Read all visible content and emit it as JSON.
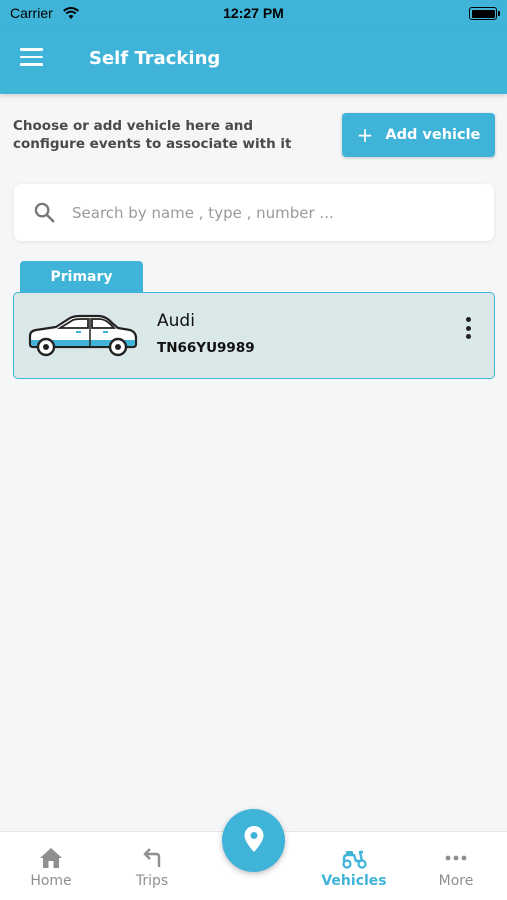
{
  "status_bar": {
    "carrier": "Carrier",
    "time": "12:27 PM"
  },
  "app_bar": {
    "title": "Self Tracking",
    "menu_icon": "hamburger-menu-icon"
  },
  "intro": {
    "text": "Choose or add vehicle here and configure events to associate with it",
    "add_button_label": "Add vehicle"
  },
  "search": {
    "placeholder": "Search by name , type , number ...",
    "value": ""
  },
  "vehicles": [
    {
      "tag": "Primary",
      "name": "Audi",
      "number": "TN66YU9989",
      "icon": "car-icon"
    }
  ],
  "bottom_nav": {
    "items": [
      {
        "label": "Home",
        "icon": "home-icon"
      },
      {
        "label": "Trips",
        "icon": "turn-left-arrow-icon"
      },
      {
        "label": "Vehicles",
        "icon": "scooter-icon",
        "active": true
      },
      {
        "label": "More",
        "icon": "more-dots-icon"
      }
    ],
    "fab_icon": "location-pin-icon"
  },
  "colors": {
    "accent": "#40b3d9",
    "card_bg": "#dbe8ea",
    "background": "#f5f6f7"
  }
}
